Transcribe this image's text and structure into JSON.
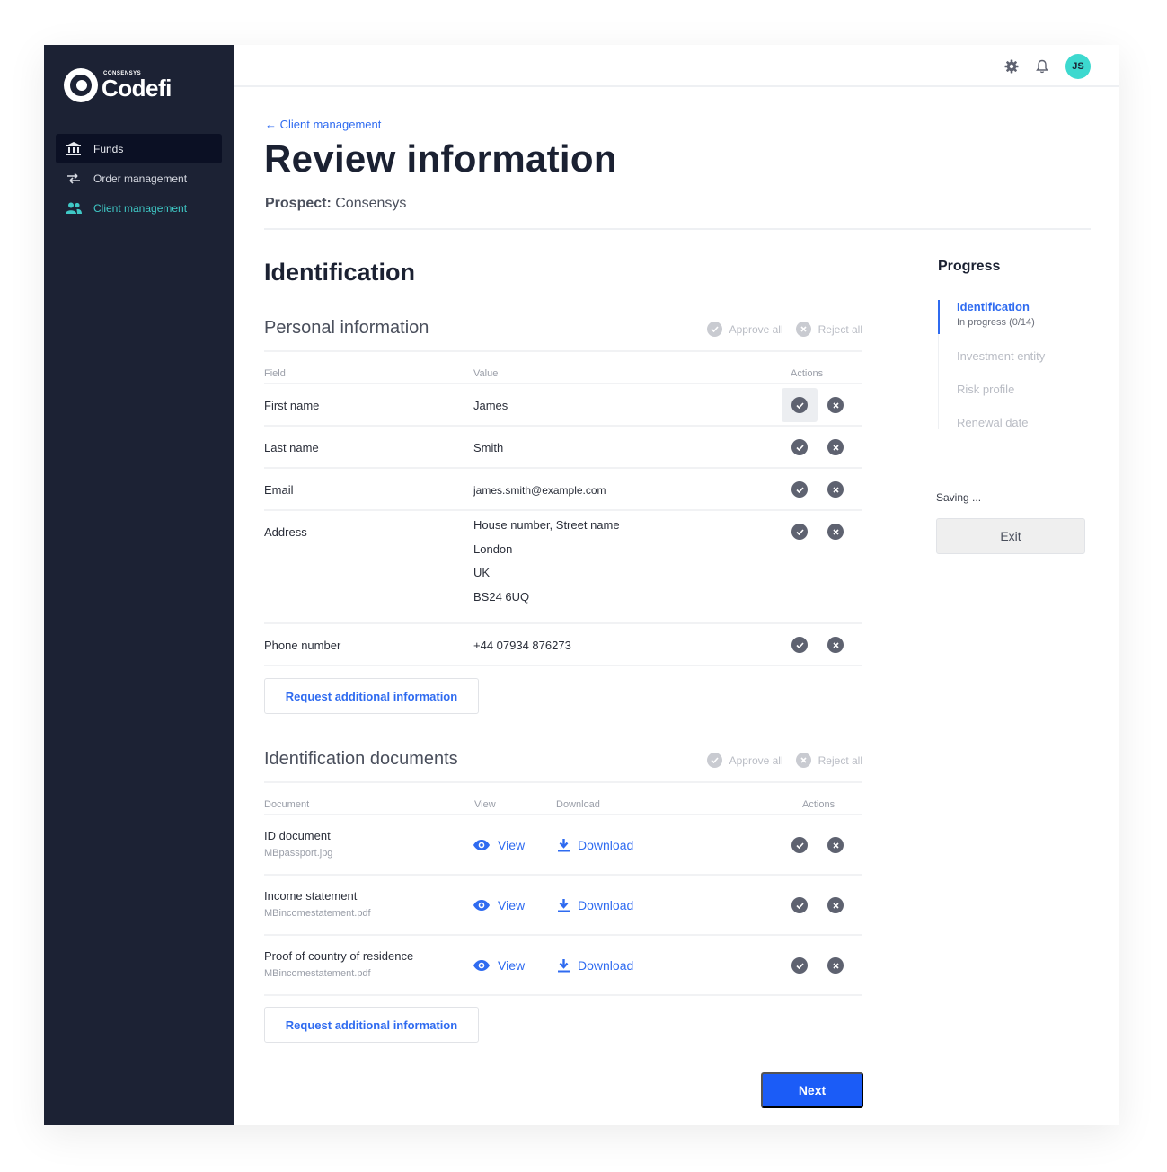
{
  "brand": {
    "small": "CONSENSYS",
    "name": "Codefi"
  },
  "sidebar": {
    "items": [
      {
        "label": "Funds",
        "icon": "bank-icon",
        "state": "active"
      },
      {
        "label": "Order management",
        "icon": "swap-arrows-icon",
        "state": "default"
      },
      {
        "label": "Client management",
        "icon": "users-icon",
        "state": "current"
      }
    ]
  },
  "topbar": {
    "avatar_initials": "JS",
    "icons": [
      "gear-icon",
      "bell-icon"
    ]
  },
  "header": {
    "back_label": "← Client management",
    "title": "Review information",
    "prospect_label": "Prospect:",
    "prospect_value": "Consensys"
  },
  "section": {
    "title": "Identification"
  },
  "personal": {
    "title": "Personal information",
    "approve_all": "Approve all",
    "reject_all": "Reject all",
    "columns": {
      "field": "Field",
      "value": "Value",
      "actions": "Actions"
    },
    "rows": [
      {
        "field": "First name",
        "value": "James"
      },
      {
        "field": "Last name",
        "value": "Smith"
      },
      {
        "field": "Email",
        "value": "james.smith@example.com"
      },
      {
        "field": "Address",
        "lines": [
          "House number, Street name",
          "London",
          "UK",
          "BS24 6UQ"
        ]
      },
      {
        "field": "Phone number",
        "value": "+44 07934 876273"
      }
    ],
    "request_label": "Request additional information"
  },
  "documents": {
    "title": "Identification documents",
    "approve_all": "Approve all",
    "reject_all": "Reject all",
    "columns": {
      "document": "Document",
      "view": "View",
      "download": "Download",
      "actions": "Actions"
    },
    "rows": [
      {
        "name": "ID document",
        "file": "MBpassport.jpg",
        "view": "View",
        "download": "Download"
      },
      {
        "name": "Income statement",
        "file": "MBincomestatement.pdf",
        "view": "View",
        "download": "Download"
      },
      {
        "name": "Proof of country of residence",
        "file": "MBincomestatement.pdf",
        "view": "View",
        "download": "Download"
      }
    ],
    "request_label": "Request additional information"
  },
  "next_label": "Next",
  "progress": {
    "title": "Progress",
    "steps": [
      {
        "label": "Identification",
        "status": "In progress (0/14)",
        "active": true
      },
      {
        "label": "Investment entity"
      },
      {
        "label": "Risk profile"
      },
      {
        "label": "Renewal date"
      }
    ],
    "saving": "Saving ...",
    "exit_label": "Exit"
  },
  "colors": {
    "sidebar": "#1c2234",
    "accent": "#2f6bf0",
    "primary_button": "#1b5cf7",
    "avatar": "#3dd9cf",
    "current_nav": "#3fc9c6"
  }
}
